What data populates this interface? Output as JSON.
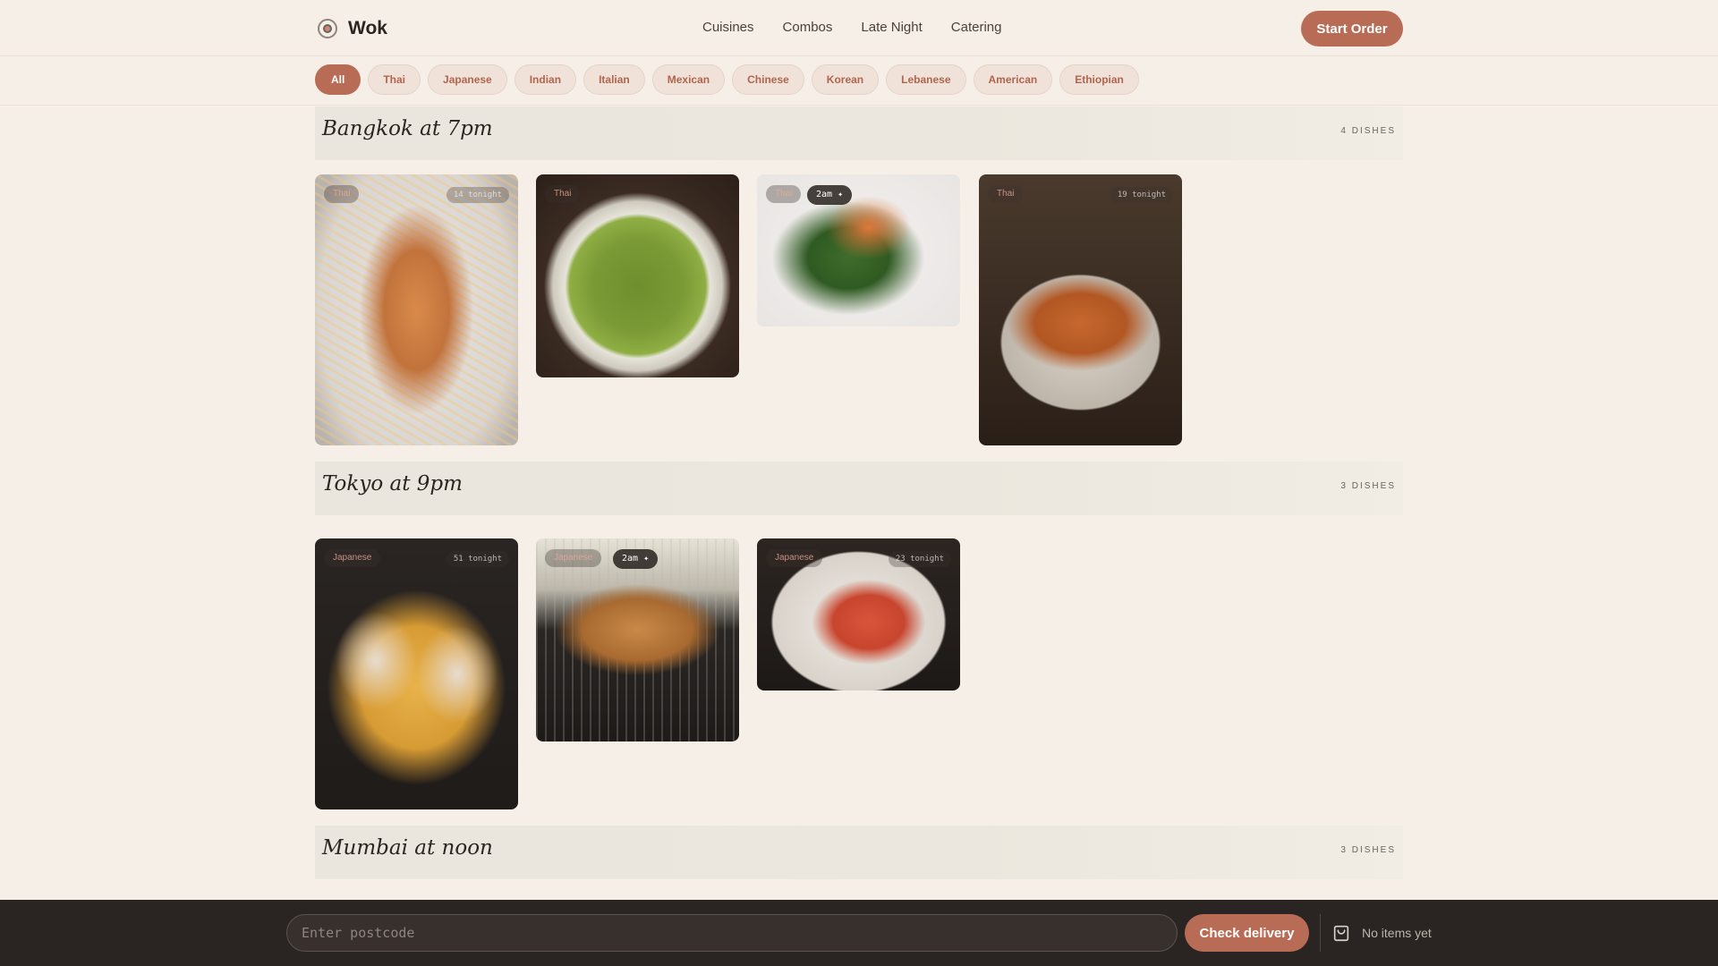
{
  "header": {
    "brand": "Wok",
    "nav": [
      "Cuisines",
      "Combos",
      "Late Night",
      "Catering"
    ],
    "cta": "Start Order"
  },
  "filters": {
    "chips": [
      "All",
      "Thai",
      "Japanese",
      "Indian",
      "Italian",
      "Mexican",
      "Chinese",
      "Korean",
      "Lebanese",
      "American",
      "Ethiopian"
    ],
    "active": "All"
  },
  "sections": [
    {
      "title": "Bangkok at 7pm",
      "count": "4 DISHES",
      "cards": [
        {
          "tag": "Thai",
          "tonight": "14 tonight",
          "image": "pad-thai"
        },
        {
          "tag": "Thai",
          "image": "green-curry"
        },
        {
          "tag": "Thai",
          "late": "2am ✦",
          "image": "papaya-salad"
        },
        {
          "tag": "Thai",
          "tonight": "19 tonight",
          "image": "massaman-curry"
        }
      ]
    },
    {
      "title": "Tokyo at 9pm",
      "count": "3 DISHES",
      "cards": [
        {
          "tag": "Japanese",
          "tonight": "51 tonight",
          "image": "tonkotsu-ramen"
        },
        {
          "tag": "Japanese",
          "late": "2am ✦",
          "image": "tonkatsu"
        },
        {
          "tag": "Japanese",
          "tonight": "23 tonight",
          "image": "chirashi-bowl"
        }
      ]
    },
    {
      "title": "Mumbai at noon",
      "count": "3 DISHES"
    }
  ],
  "bottom": {
    "postcode_placeholder": "Enter postcode",
    "check_label": "Check delivery",
    "cart_text": "No items yet"
  },
  "colors": {
    "accent": "#b86c55",
    "background": "#f6efe7",
    "bottom_bar": "#2a2523"
  }
}
